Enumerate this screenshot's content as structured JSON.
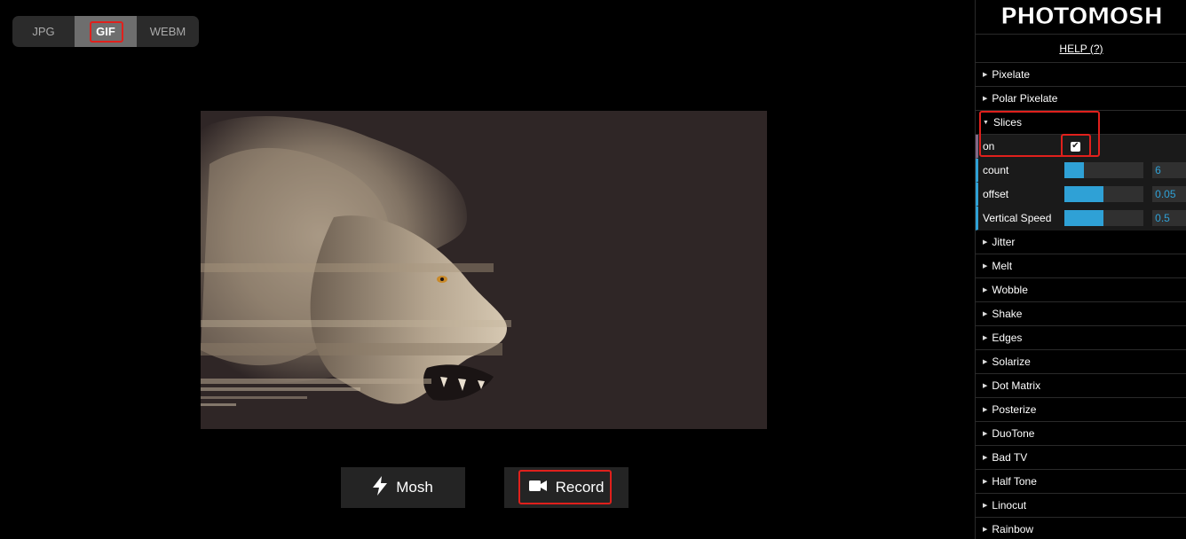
{
  "formats": [
    {
      "label": "JPG",
      "active": false
    },
    {
      "label": "GIF",
      "active": true
    },
    {
      "label": "WEBM",
      "active": false
    }
  ],
  "actions": {
    "mosh_label": "Mosh",
    "record_label": "Record"
  },
  "panel": {
    "logo": "PHOTOMOSH",
    "help": "HELP (?)",
    "folders_top": [
      "Pixelate",
      "Polar Pixelate"
    ],
    "open_folder": {
      "label": "Slices",
      "controls": [
        {
          "label": "on",
          "type": "checkbox",
          "checked": true
        },
        {
          "label": "count",
          "type": "slider",
          "value": "6",
          "fill": 0.25
        },
        {
          "label": "offset",
          "type": "slider",
          "value": "0.05",
          "fill": 0.5
        },
        {
          "label": "Vertical Speed",
          "type": "slider",
          "value": "0.5",
          "fill": 0.5
        }
      ]
    },
    "folders_bottom": [
      "Jitter",
      "Melt",
      "Wobble",
      "Shake",
      "Edges",
      "Solarize",
      "Dot Matrix",
      "Posterize",
      "DuoTone",
      "Bad TV",
      "Half Tone",
      "Linocut",
      "Rainbow"
    ]
  },
  "colors": {
    "accent": "#2fa1d6",
    "highlight": "#e0201c",
    "canvas_bg": "#2f2626"
  }
}
